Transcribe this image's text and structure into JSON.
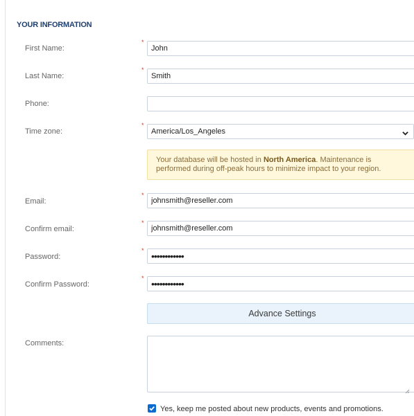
{
  "section": {
    "title": "YOUR INFORMATION"
  },
  "fields": {
    "first_name": {
      "label": "First Name:",
      "value": "John"
    },
    "last_name": {
      "label": "Last Name:",
      "value": "Smith"
    },
    "phone": {
      "label": "Phone:",
      "value": ""
    },
    "time_zone": {
      "label": "Time zone:",
      "value": "America/Los_Angeles"
    },
    "email": {
      "label": "Email:",
      "value": "johnsmith@reseller.com"
    },
    "confirm_email": {
      "label": "Confirm email:",
      "value": "johnsmith@reseller.com"
    },
    "password": {
      "label": "Password:",
      "value": "••••••••••••"
    },
    "confirm_password": {
      "label": "Confirm Password:",
      "value": "••••••••••••"
    },
    "comments": {
      "label": "Comments:",
      "value": ""
    }
  },
  "required_marker": "*",
  "notice": {
    "text_before": "Your database will be hosted in ",
    "region": "North America",
    "text_after": ". Maintenance is",
    "line2": "performed during off-peak hours to minimize impact to your region."
  },
  "advance_settings": {
    "label": "Advance Settings"
  },
  "newsletter": {
    "checked": true,
    "label": "Yes, keep me posted about new products, events and promotions."
  },
  "icons": {
    "select": "chevron-down-icon",
    "checkbox": "checkmark-icon",
    "resize": "resize-handle-icon"
  },
  "colors": {
    "section_title": "#1f3f6e",
    "required": "#d23b2c",
    "notice_bg": "#fff8dc",
    "button_bg": "#eaf3fb",
    "checkbox": "#0b6bd0"
  }
}
